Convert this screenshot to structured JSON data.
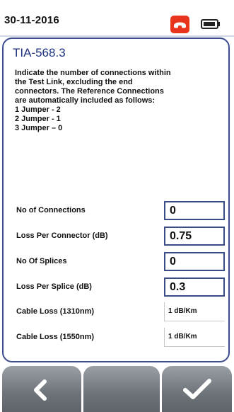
{
  "statusbar": {
    "date": "30-11-2016",
    "phone_icon": "phone-hangup-icon",
    "battery_icon": "battery-icon",
    "phone_color": "#e8341c"
  },
  "panel": {
    "title": "TIA-568.3",
    "instructions": [
      "Indicate the number of connections within",
      "the Test Link, excluding the end",
      "connectors. The Reference Connections",
      "are automatically included as follows:",
      "1 Jumper - 2",
      "2 Jumper - 1",
      "3 Jumper – 0"
    ],
    "fields": {
      "connections": {
        "label": "No of Connections",
        "value": "0"
      },
      "loss_per_connector": {
        "label": "Loss Per Connector (dB)",
        "value": "0.75"
      },
      "splices": {
        "label": "No Of Splices",
        "value": "0"
      },
      "loss_per_splice": {
        "label": "Loss Per Splice (dB)",
        "value": "0.3"
      },
      "cable_loss_1310": {
        "label": "Cable Loss (1310nm)",
        "value": "1 dB/Km"
      },
      "cable_loss_1550": {
        "label": "Cable Loss (1550nm)",
        "value": "1 dB/Km"
      }
    },
    "accent_color": "#1f3380"
  },
  "buttons": {
    "back_icon": "chevron-left-icon",
    "middle_icon": "",
    "confirm_icon": "checkmark-icon"
  }
}
